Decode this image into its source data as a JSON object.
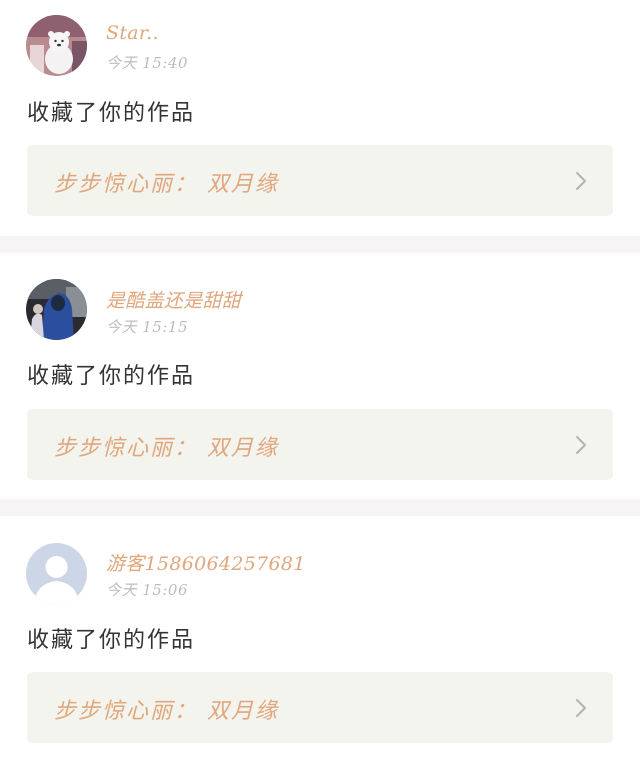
{
  "notifications": [
    {
      "username": "Star..",
      "time": "今天 15:40",
      "action": "收藏了你的作品",
      "work_title": "步步惊心丽： 双月缘",
      "avatar": "polar-bear-avatar"
    },
    {
      "username": "是酷盖还是甜甜",
      "time": "今天 15:15",
      "action": "收藏了你的作品",
      "work_title": "步步惊心丽： 双月缘",
      "avatar": "photo-avatar"
    },
    {
      "username": "游客1586064257681",
      "time": "今天 15:06",
      "action": "收藏了你的作品",
      "work_title": "步步惊心丽： 双月缘",
      "avatar": "default-user-avatar"
    }
  ],
  "colors": {
    "accent": "#e0a67c",
    "muted": "#bdbdbd",
    "text": "#333333",
    "work_bg": "#f4f4ee",
    "separator": "#f6f4f4"
  },
  "icons": {
    "chevron": "chevron-right-icon"
  }
}
